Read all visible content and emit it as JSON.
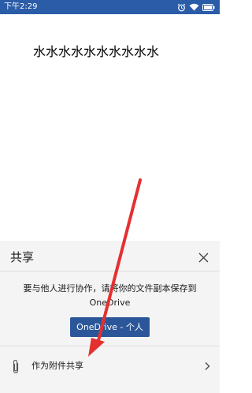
{
  "status_bar": {
    "time": "下午2:29",
    "icons": [
      "alarm-icon",
      "wifi-icon",
      "battery-icon"
    ]
  },
  "document": {
    "body_text": "水水水水水水水水水水"
  },
  "share_sheet": {
    "title": "共享",
    "message": "要与他人进行协作，请将你的文件副本保存到 OneDrive",
    "onedrive_button_label": "OneDrive - 个人",
    "attach_label": "作为附件共享"
  },
  "colors": {
    "status_bar_bg": "#2a5ca8",
    "primary_button": "#2b579a",
    "sheet_bg": "#f4f4f4",
    "annotation_arrow": "#e53030"
  }
}
